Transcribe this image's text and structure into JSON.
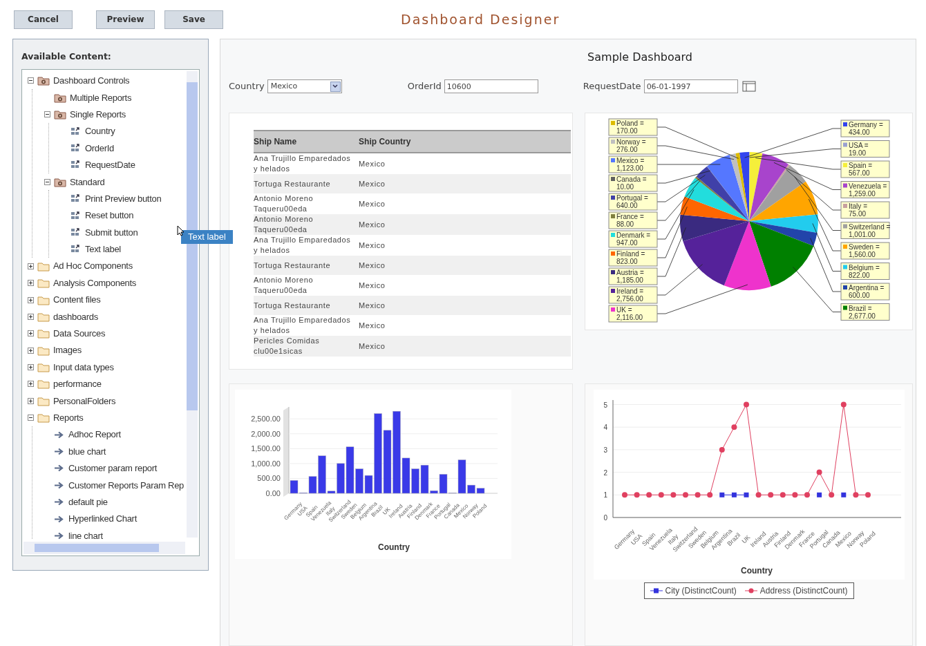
{
  "toolbar": {
    "buttons": [
      "Cancel",
      "Preview",
      "Save"
    ],
    "title": "Dashboard Designer"
  },
  "sidebar": {
    "heading": "Available Content:",
    "tree": [
      {
        "label": "Dashboard Controls",
        "kind": "controls-folder",
        "expanded": true,
        "children": [
          {
            "label": "Multiple Reports",
            "kind": "controls-folder"
          },
          {
            "label": "Single Reports",
            "kind": "controls-folder",
            "expanded": true,
            "children": [
              {
                "label": "Country",
                "kind": "component"
              },
              {
                "label": "OrderId",
                "kind": "component"
              },
              {
                "label": "RequestDate",
                "kind": "component"
              }
            ]
          },
          {
            "label": "Standard",
            "kind": "controls-folder",
            "expanded": true,
            "children": [
              {
                "label": "Print Preview button",
                "kind": "component"
              },
              {
                "label": "Reset button",
                "kind": "component"
              },
              {
                "label": "Submit button",
                "kind": "component"
              },
              {
                "label": "Text label",
                "kind": "component"
              }
            ]
          }
        ]
      },
      {
        "label": "Ad Hoc Components",
        "kind": "folder",
        "expanded": false
      },
      {
        "label": "Analysis Components",
        "kind": "folder",
        "expanded": false
      },
      {
        "label": "Content files",
        "kind": "folder",
        "expanded": false
      },
      {
        "label": "dashboards",
        "kind": "folder",
        "expanded": false
      },
      {
        "label": "Data Sources",
        "kind": "folder",
        "expanded": false
      },
      {
        "label": "Images",
        "kind": "folder",
        "expanded": false
      },
      {
        "label": "Input data types",
        "kind": "folder",
        "expanded": false
      },
      {
        "label": "performance",
        "kind": "folder",
        "expanded": false
      },
      {
        "label": "PersonalFolders",
        "kind": "folder",
        "expanded": false
      },
      {
        "label": "Reports",
        "kind": "folder",
        "expanded": true,
        "children": [
          {
            "label": "Adhoc Report",
            "kind": "report"
          },
          {
            "label": "blue chart",
            "kind": "report"
          },
          {
            "label": "Customer param report",
            "kind": "report"
          },
          {
            "label": "Customer Reports Param Rep",
            "kind": "report"
          },
          {
            "label": "default pie",
            "kind": "report"
          },
          {
            "label": "Hyperlinked Chart",
            "kind": "report"
          },
          {
            "label": "line chart",
            "kind": "report"
          }
        ]
      }
    ]
  },
  "drag_ghost": {
    "label": "Text label"
  },
  "dashboard": {
    "title": "Sample Dashboard",
    "filters": {
      "country": {
        "label": "Country",
        "value": "Mexico"
      },
      "order_id": {
        "label": "OrderId",
        "value": "10600"
      },
      "request_date": {
        "label": "RequestDate",
        "value": "06-01-1997"
      }
    },
    "table": {
      "columns": [
        "Ship Name",
        "Ship Country"
      ],
      "rows": [
        [
          "Ana Trujillo Emparedados y helados",
          "Mexico"
        ],
        [
          "Tortuga Restaurante",
          "Mexico"
        ],
        [
          "Antonio Moreno Taqueru00eda",
          "Mexico"
        ],
        [
          "Antonio Moreno Taqueru00eda",
          "Mexico"
        ],
        [
          "Ana Trujillo Emparedados y helados",
          "Mexico"
        ],
        [
          "Tortuga Restaurante",
          "Mexico"
        ],
        [
          "Antonio Moreno Taqueru00eda",
          "Mexico"
        ],
        [
          "Tortuga Restaurante",
          "Mexico"
        ],
        [
          "Ana Trujillo Emparedados y helados",
          "Mexico"
        ],
        [
          "Pericles Comidas clu00e1sicas",
          "Mexico"
        ]
      ]
    },
    "pie": {
      "label_separator": "=",
      "chart_data": {
        "type": "pie",
        "data_labels": true,
        "legend": "top left",
        "categories": [
          "Germany",
          "USA",
          "Spain",
          "Venezuela",
          "Italy",
          "Switzerland",
          "Sweden",
          "Belgium",
          "Argentina",
          "Brazil",
          "UK",
          "Ireland",
          "Austria",
          "Finland",
          "Denmark",
          "France",
          "Portugal",
          "Canada",
          "Mexico",
          "Norway",
          "Poland"
        ],
        "values": [
          434,
          19,
          567,
          1259,
          75,
          1001,
          1560,
          822,
          600,
          2677,
          2116,
          2756,
          1185,
          823,
          947,
          88,
          640,
          10,
          1123,
          276,
          170
        ],
        "value_labels": [
          "434.00",
          "19.00",
          "567.00",
          "1,259.00",
          "75.00",
          "1,001.00",
          "1,560.00",
          "822.00",
          "600.00",
          "2,677.00",
          "2,116.00",
          "2,756.00",
          "1,185.00",
          "823.00",
          "947.00",
          "88.00",
          "640.00",
          "10.00",
          "1,123.00",
          "276.00",
          "170.00"
        ],
        "colors": [
          "#3344ee",
          "#9aa0d0",
          "#f5ef3a",
          "#a844cc",
          "#c8a0a0",
          "#a0a0a0",
          "#ffa500",
          "#22ccee",
          "#2244aa",
          "#008000",
          "#ee33cc",
          "#55229a",
          "#3a2a80",
          "#ff6600",
          "#22dddd",
          "#808040",
          "#4040a8",
          "#606060",
          "#5577ff",
          "#c0c0c0",
          "#ddbb00"
        ]
      }
    },
    "bar": {
      "chart_data": {
        "type": "bar",
        "xlabel": "Country",
        "ylim": [
          0,
          2900
        ],
        "grid": true,
        "categories": [
          "Germany",
          "USA",
          "Spain",
          "Venezuela",
          "Italy",
          "Switzerland",
          "Sweden",
          "Belgium",
          "Argentina",
          "Brazil",
          "UK",
          "Ireland",
          "Austria",
          "Finland",
          "Denmark",
          "France",
          "Portugal",
          "Canada",
          "Mexico",
          "Norway",
          "Poland"
        ],
        "series": [
          {
            "color": "#3a3ae8",
            "values": [
              434,
              19,
              567,
              1259,
              75,
              1001,
              1560,
              822,
              600,
              2677,
              2116,
              2756,
              1185,
              823,
              947,
              88,
              640,
              10,
              1123,
              276,
              170
            ]
          }
        ],
        "yticks": [
          {
            "value": 0,
            "label": "0.00"
          },
          {
            "value": 500,
            "label": "500.00"
          },
          {
            "value": 1000,
            "label": "1,000.00"
          },
          {
            "value": 1500,
            "label": "1,500.00"
          },
          {
            "value": 2000,
            "label": "2,000.00"
          },
          {
            "value": 2500,
            "label": "2,500.00"
          }
        ]
      }
    },
    "line": {
      "chart_data": {
        "type": "line",
        "xlabel": "Country",
        "ylim": [
          0,
          5.2
        ],
        "grid": true,
        "categories": [
          "Germany",
          "USA",
          "Spain",
          "Venezuela",
          "Italy",
          "Switzerland",
          "Sweden",
          "Belgium",
          "Argentina",
          "Brazil",
          "UK",
          "Ireland",
          "Austria",
          "Finland",
          "Denmark",
          "France",
          "Portugal",
          "Canada",
          "Mexico",
          "Norway",
          "Poland"
        ],
        "series": [
          {
            "name": "City (DistinctCount)",
            "color": "#3333dd",
            "marker": "square",
            "values": [
              null,
              null,
              null,
              null,
              null,
              null,
              null,
              null,
              1,
              1,
              1,
              null,
              null,
              null,
              null,
              null,
              1,
              null,
              1,
              null,
              null
            ]
          },
          {
            "name": "Address (DistinctCount)",
            "color": "#e04060",
            "marker": "circle",
            "values": [
              1,
              1,
              1,
              1,
              1,
              1,
              1,
              1,
              3,
              4,
              5,
              1,
              1,
              1,
              1,
              1,
              2,
              1,
              5,
              1,
              1
            ]
          }
        ],
        "yticks": [
          0,
          1,
          2,
          3,
          4,
          5
        ]
      }
    }
  }
}
